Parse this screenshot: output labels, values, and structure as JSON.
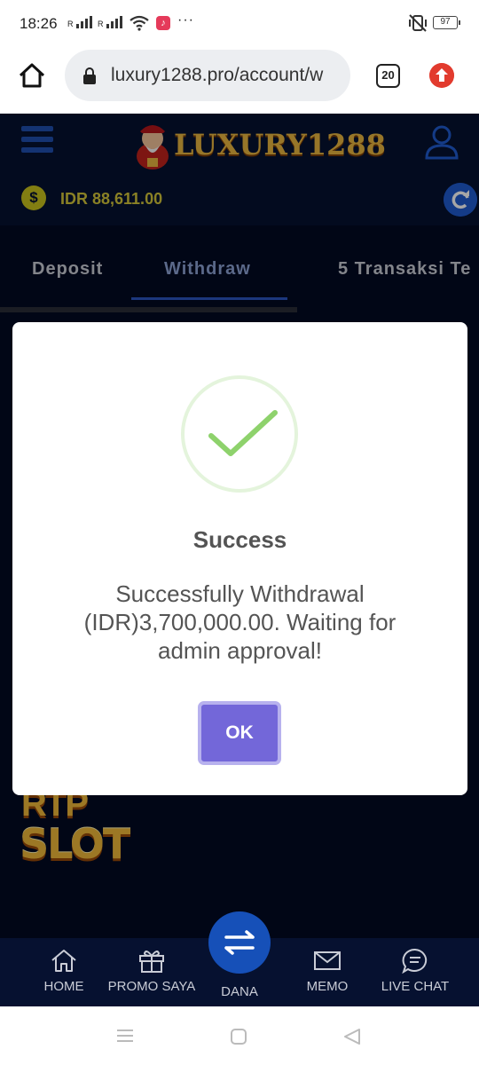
{
  "status_bar": {
    "time": "18:26",
    "battery": "97"
  },
  "browser": {
    "url": "luxury1288.pro/account/w",
    "tab_count": "20"
  },
  "site": {
    "logo_text": "LUXURY1288",
    "balance": "IDR 88,611.00",
    "tabs": [
      "Deposit",
      "Withdraw",
      "5 Transaksi Te"
    ],
    "active_tab": "Withdraw",
    "banner_text": [
      "RTP",
      "SLOT"
    ]
  },
  "modal": {
    "title": "Success",
    "message": "Successfully Withdrawal (IDR)3,700,000.00. Waiting for admin approval!",
    "ok_label": "OK"
  },
  "bottom_nav": [
    {
      "label": "HOME",
      "icon": "home-icon"
    },
    {
      "label": "PROMO SAYA",
      "icon": "gift-icon"
    },
    {
      "label": "DANA",
      "icon": "transfer-icon"
    },
    {
      "label": "MEMO",
      "icon": "mail-icon"
    },
    {
      "label": "LIVE CHAT",
      "icon": "chat-icon"
    }
  ],
  "colors": {
    "site_bg": "#030a22",
    "header_bg": "#061130",
    "balance": "#d4c73a",
    "ok_button": "#7367d9",
    "success_green": "#8ed26c",
    "accent_blue": "#1f5bd0"
  }
}
